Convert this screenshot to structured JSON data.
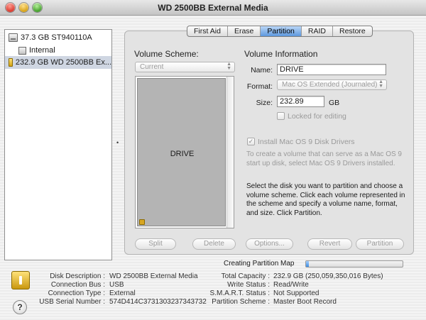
{
  "window": {
    "title": "WD 2500BB External Media"
  },
  "sidebar": {
    "items": [
      {
        "label": "37.3 GB ST940110A"
      },
      {
        "label": "Internal"
      },
      {
        "label": "232.9 GB WD 2500BB Ex..."
      }
    ]
  },
  "tabs": [
    "First Aid",
    "Erase",
    "Partition",
    "RAID",
    "Restore"
  ],
  "partition": {
    "scheme_title": "Volume Scheme:",
    "scheme_value": "Current",
    "map_volume_name": "DRIVE",
    "info_title": "Volume Information",
    "name_label": "Name:",
    "name_value": "DRIVE",
    "format_label": "Format:",
    "format_value": "Mac OS Extended (Journaled)",
    "size_label": "Size:",
    "size_value": "232.89",
    "size_unit": "GB",
    "locked_label": "Locked for editing",
    "install_label": "Install Mac OS 9 Disk Drivers",
    "install_help": "To create a volume that can serve as a Mac OS 9 start up disk, select Mac OS 9 Drivers installed.",
    "instructions": "Select the disk you want to partition and choose a volume scheme. Click each volume represented in the scheme and specify a volume name, format, and size. Click Partition.",
    "buttons": {
      "split": "Split",
      "delete": "Delete",
      "options": "Options...",
      "revert": "Revert",
      "partition": "Partition"
    }
  },
  "progress": {
    "label": "Creating Partition Map",
    "fraction": 0.03
  },
  "details": {
    "left": [
      {
        "key": "Disk Description :",
        "value": "WD 2500BB External Media"
      },
      {
        "key": "Connection Bus :",
        "value": "USB"
      },
      {
        "key": "Connection Type :",
        "value": "External"
      },
      {
        "key": "USB Serial Number :",
        "value": "574D414C3731303237343732"
      }
    ],
    "right": [
      {
        "key": "Total Capacity :",
        "value": "232.9 GB (250,059,350,016 Bytes)"
      },
      {
        "key": "Write Status :",
        "value": "Read/Write"
      },
      {
        "key": "S.M.A.R.T. Status :",
        "value": "Not Supported"
      },
      {
        "key": "Partition Scheme :",
        "value": "Master Boot Record"
      }
    ]
  },
  "help": {
    "label": "?"
  }
}
